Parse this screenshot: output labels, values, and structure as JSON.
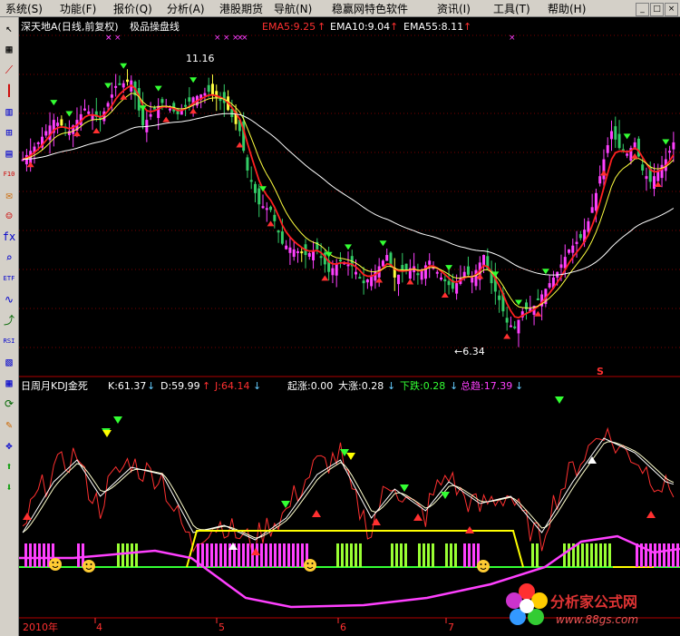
{
  "menu": [
    {
      "label": "系统(S)"
    },
    {
      "label": "功能(F)"
    },
    {
      "label": "报价(Q)"
    },
    {
      "label": "分析(A)"
    },
    {
      "label": "港股期货"
    },
    {
      "label": "导航(N)"
    },
    {
      "label": "稳赢网特色软件"
    },
    {
      "label": "资讯(I)"
    },
    {
      "label": "工具(T)"
    },
    {
      "label": "帮助(H)"
    }
  ],
  "window_buttons": [
    "_",
    "□",
    "×"
  ],
  "toolbar_icons": [
    "cursor-icon",
    "grid-icon",
    "line-chart-icon",
    "candlestick-icon",
    "bar-icon",
    "split-icon",
    "doc-icon",
    "f10-icon",
    "mail-icon",
    "people-icon",
    "f-formula-icon",
    "search-icon",
    "etf-icon",
    "wave-icon",
    "trend-icon",
    "rsi-icon",
    "chart2-icon",
    "table-icon",
    "refresh-icon",
    "pencil-icon",
    "move-icon",
    "arrow-up-icon",
    "arrow-down-icon"
  ],
  "toolbar_labels": [
    "↖",
    "▦",
    "⟋",
    "┃",
    "▥",
    "⊞",
    "▤",
    "F10",
    "✉",
    "☺",
    "fx",
    "⌕",
    "ETF",
    "∿",
    "⤴",
    "RSI",
    "▧",
    "▦",
    "⟳",
    "✎",
    "✥",
    "⬆",
    "⬇"
  ],
  "colors": {
    "bg": "#000000",
    "up": "#ff40ff",
    "down": "#33cc66",
    "ema5": "#ff2020",
    "ema10": "#ffff40",
    "ema55": "#ffffff",
    "k": "#ffffff",
    "d": "#ffff80",
    "j": "#ff3030",
    "grid": "#7a0000"
  },
  "price_panel": {
    "title": "深天地A(日线,前复权)",
    "indicator": "极品操盘线",
    "ema": [
      {
        "label": "EMA5:9.25",
        "arrow": "↑",
        "color": "#ff3030"
      },
      {
        "label": "EMA10:9.04",
        "arrow": "↑",
        "color": "#ffffff"
      },
      {
        "label": "EMA55:8.11",
        "arrow": "↑",
        "color": "#ffffff"
      }
    ],
    "high_label": "11.16",
    "low_label": "←6.34",
    "s_marker": "S"
  },
  "kdj_panel": {
    "title": "日周月KDJ金死",
    "k": "K:61.37",
    "k_arrow": "↓",
    "d": "D:59.99",
    "d_arrow": "↑",
    "j": "J:64.14",
    "j_arrow": "↓",
    "stats": [
      {
        "label": "起涨:0.00",
        "color": "#ffffff"
      },
      {
        "label": "大涨:0.28",
        "color": "#ffffff",
        "arrow": "↓"
      },
      {
        "label": "下跌:0.28",
        "color": "#33ff33",
        "arrow": "↓"
      },
      {
        "label": "总趋:17.39",
        "color": "#ff40ff",
        "arrow": "↓"
      }
    ]
  },
  "x_axis": [
    "2010年",
    "4",
    "5",
    "6",
    "7"
  ],
  "logo": {
    "text": "分析家公式网",
    "url": "www.88gs.com"
  }
}
